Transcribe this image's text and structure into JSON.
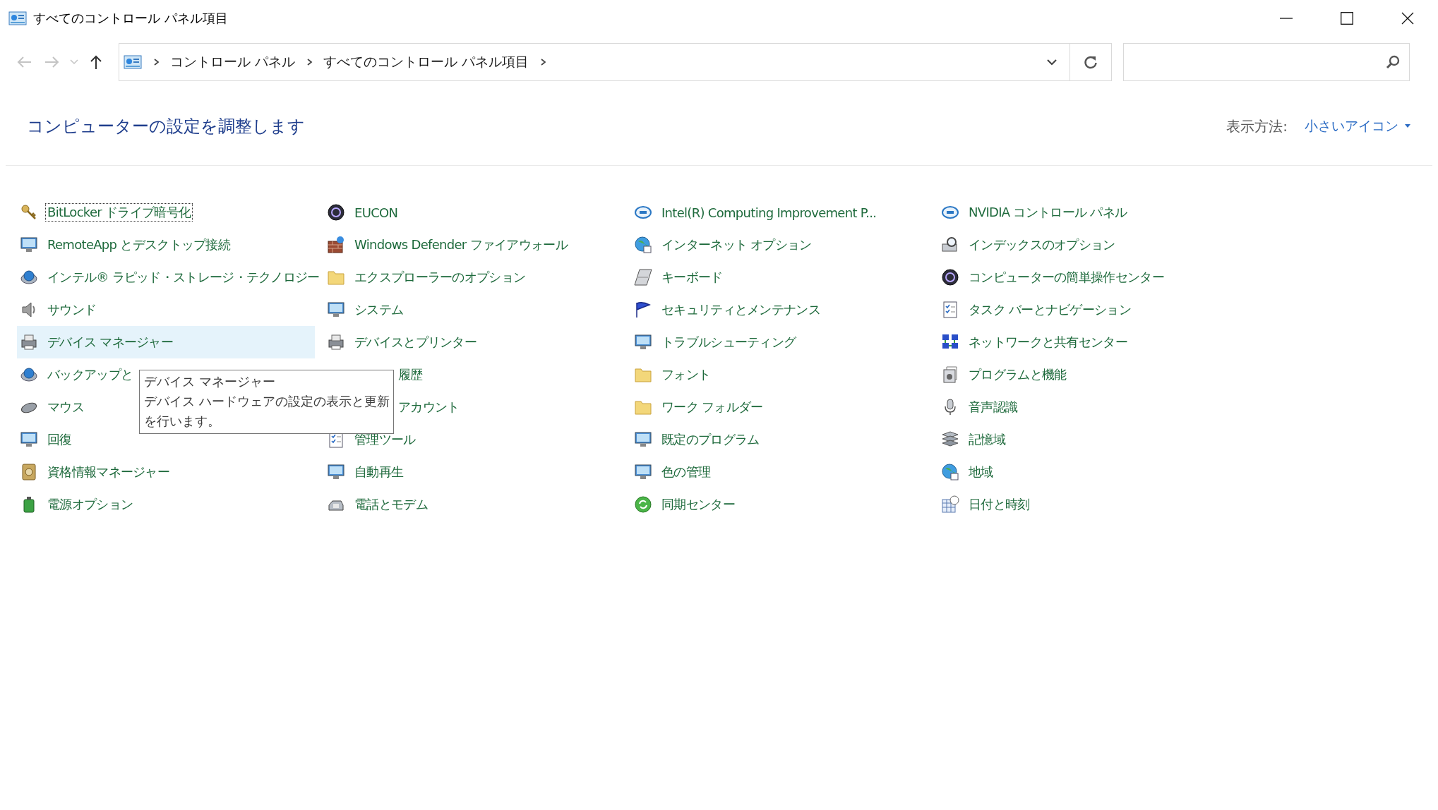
{
  "window": {
    "title": "すべてのコントロール パネル項目"
  },
  "nav_buttons": [
    {
      "kind": "back",
      "disabled": true
    },
    {
      "kind": "forward",
      "disabled": true
    },
    {
      "kind": "recent",
      "disabled": true
    },
    {
      "kind": "up",
      "disabled": false
    }
  ],
  "address": {
    "crumbs": [
      "コントロール パネル",
      "すべてのコントロール パネル項目"
    ]
  },
  "heading": "コンピューターの設定を調整します",
  "view": {
    "label": "表示方法:",
    "value": "小さいアイコン"
  },
  "columns": [
    {
      "items": [
        {
          "label": "BitLocker ドライブ暗号化",
          "kind": "applet",
          "hovered": false,
          "focused": true
        },
        {
          "label": "RemoteApp とデスクトップ接続",
          "kind": "applet",
          "hovered": false,
          "focused": false
        },
        {
          "label": "インテル® ラピッド・ストレージ・テクノロジー",
          "kind": "applet",
          "hovered": false,
          "focused": false
        },
        {
          "label": "サウンド",
          "kind": "applet",
          "hovered": false,
          "focused": false
        },
        {
          "label": "デバイス マネージャー",
          "kind": "applet",
          "hovered": true,
          "focused": false
        },
        {
          "label": "バックアップと",
          "kind": "applet",
          "hovered": false,
          "focused": false
        },
        {
          "label": "マウス",
          "kind": "applet",
          "hovered": false,
          "focused": false
        },
        {
          "label": "回復",
          "kind": "applet",
          "hovered": false,
          "focused": false
        },
        {
          "label": "資格情報マネージャー",
          "kind": "applet",
          "hovered": false,
          "focused": false
        },
        {
          "label": "電源オプション",
          "kind": "applet",
          "hovered": false,
          "focused": false
        }
      ]
    },
    {
      "items": [
        {
          "label": "EUCON",
          "kind": "applet",
          "hovered": false,
          "focused": false
        },
        {
          "label": "Windows Defender ファイアウォール",
          "kind": "applet",
          "hovered": false,
          "focused": false
        },
        {
          "label": "エクスプローラーのオプション",
          "kind": "applet",
          "hovered": false,
          "focused": false
        },
        {
          "label": "システム",
          "kind": "applet",
          "hovered": false,
          "focused": false
        },
        {
          "label": "デバイスとプリンター",
          "kind": "applet",
          "hovered": false,
          "focused": false
        },
        {
          "label": "履歴",
          "kind": "partial",
          "hovered": false,
          "focused": false
        },
        {
          "label": "アカウント",
          "kind": "partial",
          "hovered": false,
          "focused": false
        },
        {
          "label": "管理ツール",
          "kind": "applet",
          "hovered": false,
          "focused": false
        },
        {
          "label": "自動再生",
          "kind": "applet",
          "hovered": false,
          "focused": false
        },
        {
          "label": "電話とモデム",
          "kind": "applet",
          "hovered": false,
          "focused": false
        }
      ]
    },
    {
      "items": [
        {
          "label": "Intel(R) Computing Improvement P...",
          "kind": "applet",
          "hovered": false,
          "focused": false
        },
        {
          "label": "インターネット オプション",
          "kind": "applet",
          "hovered": false,
          "focused": false
        },
        {
          "label": "キーボード",
          "kind": "applet",
          "hovered": false,
          "focused": false
        },
        {
          "label": "セキュリティとメンテナンス",
          "kind": "applet",
          "hovered": false,
          "focused": false
        },
        {
          "label": "トラブルシューティング",
          "kind": "applet",
          "hovered": false,
          "focused": false
        },
        {
          "label": "フォント",
          "kind": "applet",
          "hovered": false,
          "focused": false
        },
        {
          "label": "ワーク フォルダー",
          "kind": "applet",
          "hovered": false,
          "focused": false
        },
        {
          "label": "既定のプログラム",
          "kind": "applet",
          "hovered": false,
          "focused": false
        },
        {
          "label": "色の管理",
          "kind": "applet",
          "hovered": false,
          "focused": false
        },
        {
          "label": "同期センター",
          "kind": "applet",
          "hovered": false,
          "focused": false
        }
      ]
    },
    {
      "items": [
        {
          "label": "NVIDIA コントロール パネル",
          "kind": "applet",
          "hovered": false,
          "focused": false
        },
        {
          "label": "インデックスのオプション",
          "kind": "applet",
          "hovered": false,
          "focused": false
        },
        {
          "label": "コンピューターの簡単操作センター",
          "kind": "applet",
          "hovered": false,
          "focused": false
        },
        {
          "label": "タスク バーとナビゲーション",
          "kind": "applet",
          "hovered": false,
          "focused": false
        },
        {
          "label": "ネットワークと共有センター",
          "kind": "applet",
          "hovered": false,
          "focused": false
        },
        {
          "label": "プログラムと機能",
          "kind": "applet",
          "hovered": false,
          "focused": false
        },
        {
          "label": "音声認識",
          "kind": "applet",
          "hovered": false,
          "focused": false
        },
        {
          "label": "記憶域",
          "kind": "applet",
          "hovered": false,
          "focused": false
        },
        {
          "label": "地域",
          "kind": "applet",
          "hovered": false,
          "focused": false
        },
        {
          "label": "日付と時刻",
          "kind": "applet",
          "hovered": false,
          "focused": false
        }
      ]
    }
  ],
  "tooltip": {
    "title": "デバイス マネージャー",
    "description": "デバイス ハードウェアの設定の表示と更新を行います。"
  }
}
